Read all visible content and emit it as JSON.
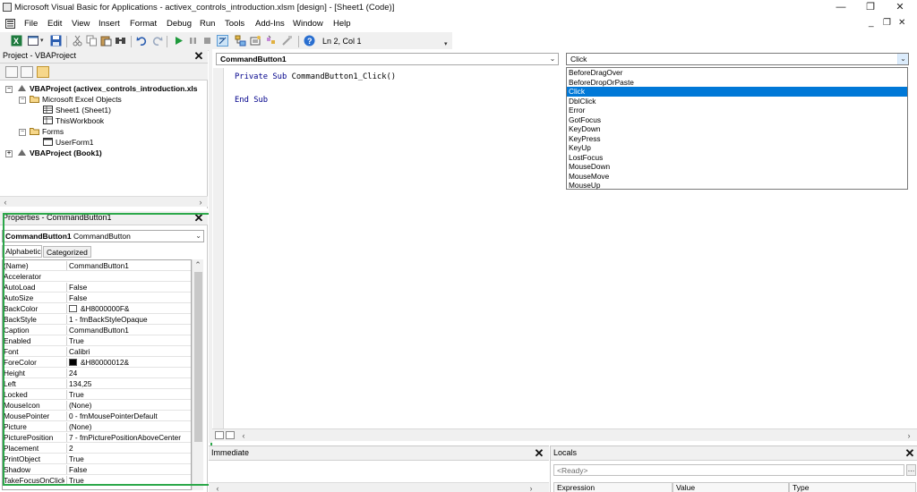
{
  "window": {
    "title": "Microsoft Visual Basic for Applications - activex_controls_introduction.xlsm [design] - [Sheet1 (Code)]",
    "minimize": "—",
    "restore": "❐",
    "close": "✕"
  },
  "menu": {
    "items": [
      "File",
      "Edit",
      "View",
      "Insert",
      "Format",
      "Debug",
      "Run",
      "Tools",
      "Add-Ins",
      "Window",
      "Help"
    ],
    "mdi_min": "_",
    "mdi_restore": "❐",
    "mdi_close": "✕"
  },
  "toolbar": {
    "position": "Ln 2, Col 1"
  },
  "project": {
    "header": "Project - VBAProject",
    "tree": [
      {
        "label": "VBAProject (activex_controls_introduction.xls",
        "bold": true,
        "toggle": "−"
      },
      {
        "label": "Microsoft Excel Objects",
        "bold": false,
        "toggle": "−"
      },
      {
        "label": "Sheet1 (Sheet1)",
        "bold": false
      },
      {
        "label": "ThisWorkbook",
        "bold": false
      },
      {
        "label": "Forms",
        "bold": false,
        "toggle": "−"
      },
      {
        "label": "UserForm1",
        "bold": false
      },
      {
        "label": "VBAProject (Book1)",
        "bold": true,
        "toggle": "+"
      }
    ]
  },
  "properties": {
    "header": "Properties - CommandButton1",
    "object_name": "CommandButton1",
    "object_type": "CommandButton",
    "tabs": [
      "Alphabetic",
      "Categorized"
    ],
    "rows": [
      {
        "name": "(Name)",
        "value": "CommandButton1"
      },
      {
        "name": "Accelerator",
        "value": ""
      },
      {
        "name": "AutoLoad",
        "value": "False"
      },
      {
        "name": "AutoSize",
        "value": "False"
      },
      {
        "name": "BackColor",
        "value": "&H8000000F&",
        "swatch": "#ffffff"
      },
      {
        "name": "BackStyle",
        "value": "1 - fmBackStyleOpaque"
      },
      {
        "name": "Caption",
        "value": "CommandButton1"
      },
      {
        "name": "Enabled",
        "value": "True"
      },
      {
        "name": "Font",
        "value": "Calibri"
      },
      {
        "name": "ForeColor",
        "value": "&H80000012&",
        "swatch": "#000000"
      },
      {
        "name": "Height",
        "value": "24"
      },
      {
        "name": "Left",
        "value": "134,25"
      },
      {
        "name": "Locked",
        "value": "True"
      },
      {
        "name": "MouseIcon",
        "value": "(None)"
      },
      {
        "name": "MousePointer",
        "value": "0 - fmMousePointerDefault"
      },
      {
        "name": "Picture",
        "value": "(None)"
      },
      {
        "name": "PicturePosition",
        "value": "7 - fmPicturePositionAboveCenter"
      },
      {
        "name": "Placement",
        "value": "2"
      },
      {
        "name": "PrintObject",
        "value": "True"
      },
      {
        "name": "Shadow",
        "value": "False"
      },
      {
        "name": "TakeFocusOnClick",
        "value": "True"
      }
    ]
  },
  "code": {
    "object_combo": "CommandButton1",
    "procedure_combo": "Click",
    "line1": "Private Sub CommandButton1_Click()",
    "line2": "End Sub",
    "kw_private": "Private",
    "kw_sub": "Sub",
    "proc_name": "CommandButton1_Click()",
    "kw_end": "End",
    "kw_sub2": "Sub",
    "events": [
      "BeforeDragOver",
      "BeforeDropOrPaste",
      "Click",
      "DblClick",
      "Error",
      "GotFocus",
      "KeyDown",
      "KeyPress",
      "KeyUp",
      "LostFocus",
      "MouseDown",
      "MouseMove",
      "MouseUp"
    ],
    "selected_event": "Click"
  },
  "immediate": {
    "header": "Immediate"
  },
  "locals": {
    "header": "Locals",
    "context": "<Ready>",
    "columns": [
      "Expression",
      "Value",
      "Type"
    ]
  },
  "colors": {
    "selection": "#0078d7",
    "highlight_box": "#2ca84a",
    "keyword": "#00008b"
  }
}
